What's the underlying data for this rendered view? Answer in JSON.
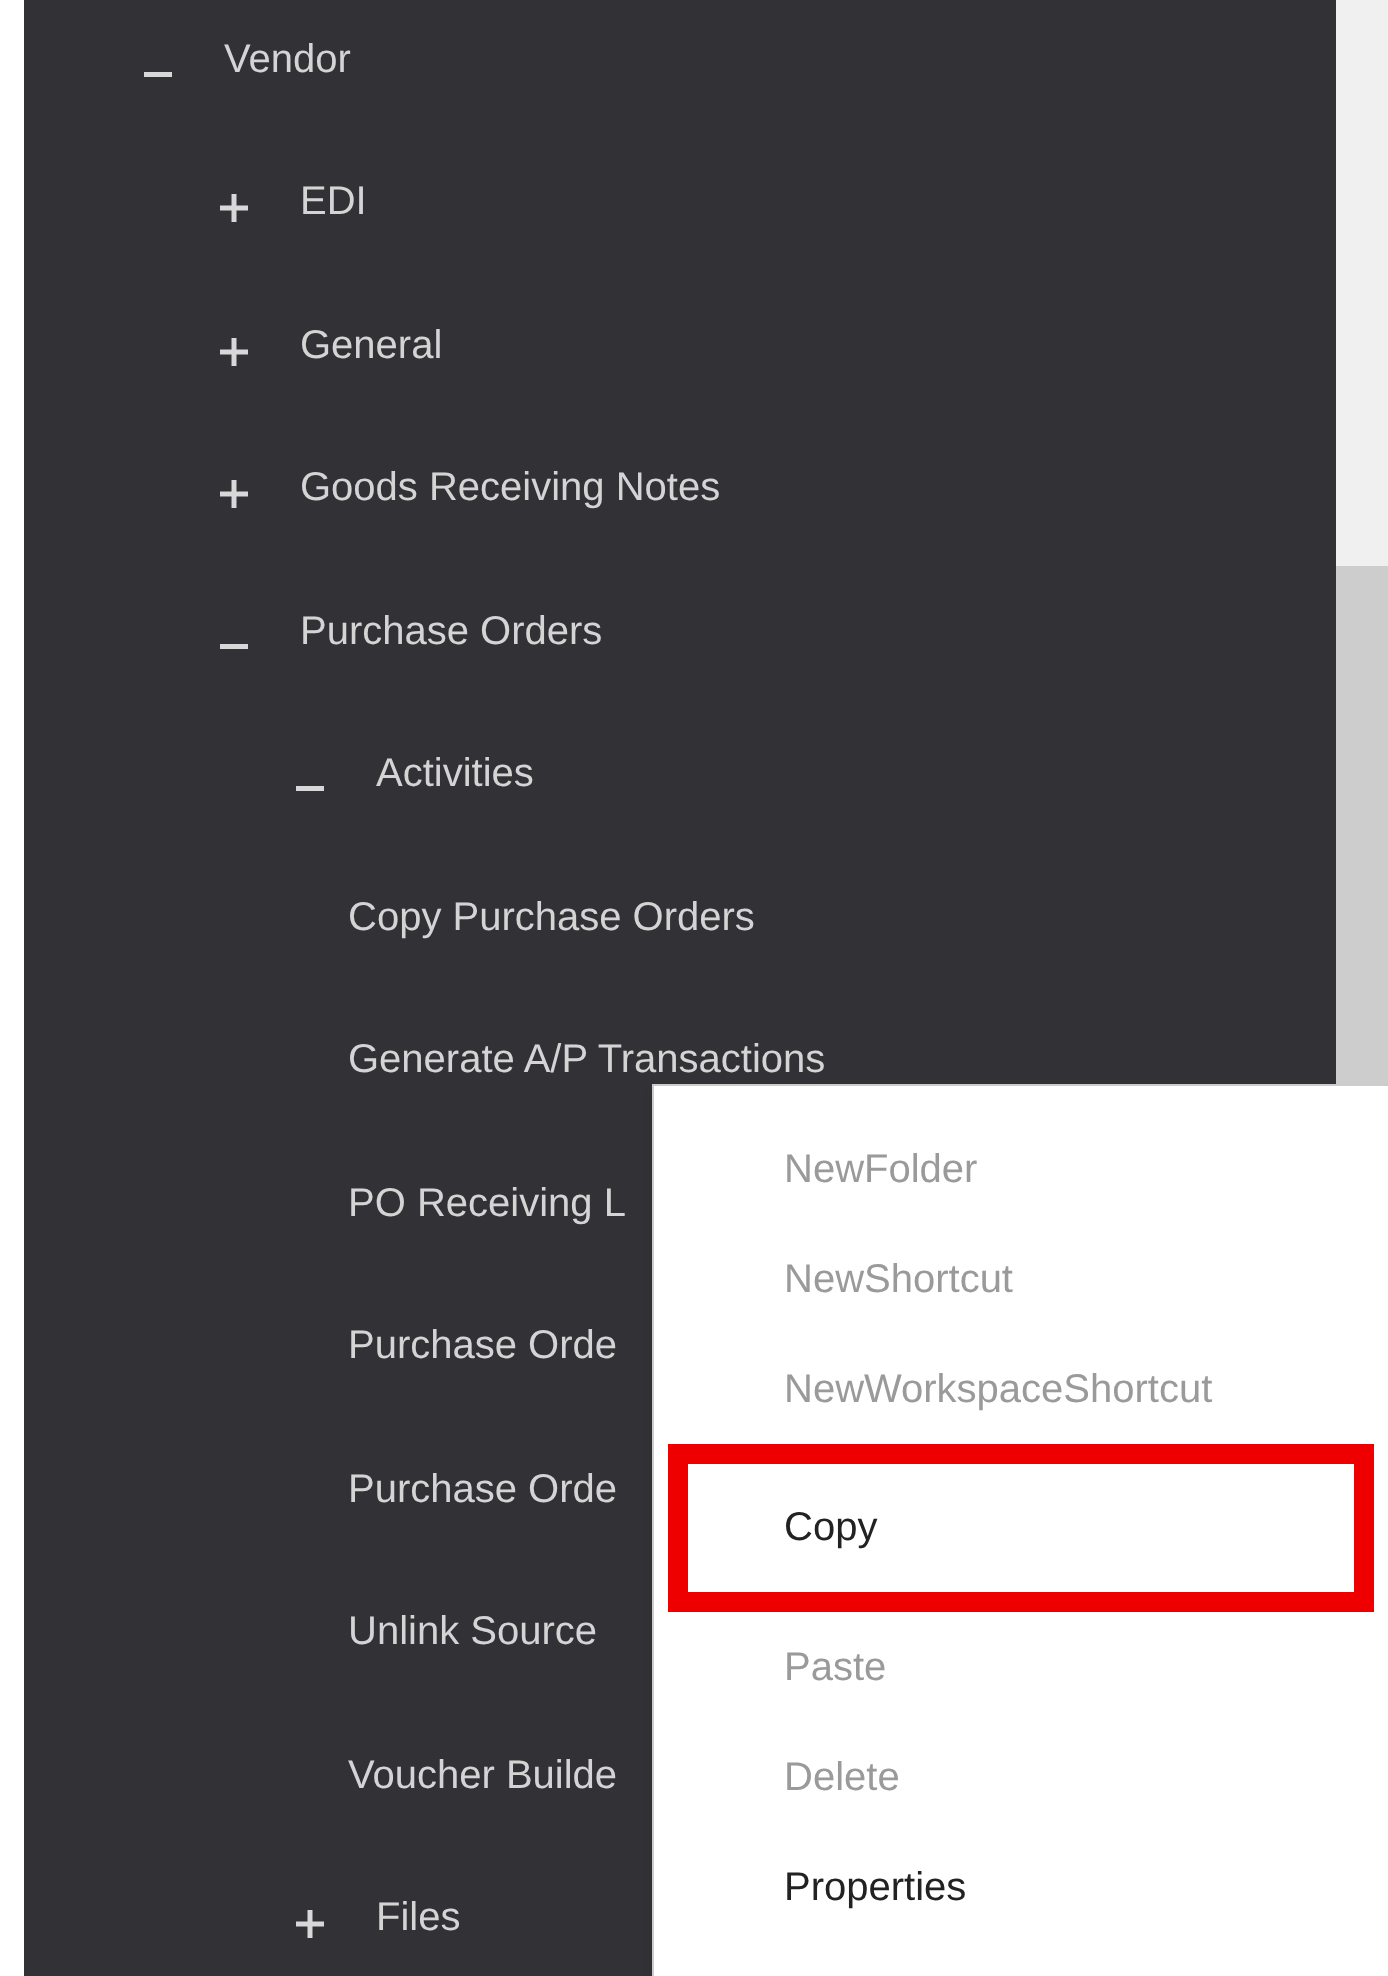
{
  "tree": [
    {
      "label": "Vendor",
      "expanded": true,
      "children": [
        {
          "label": "EDI",
          "expanded": false
        },
        {
          "label": "General",
          "expanded": false
        },
        {
          "label": "Goods Receiving Notes",
          "expanded": false
        },
        {
          "label": "Purchase Orders",
          "expanded": true,
          "children": [
            {
              "label": "Activities",
              "expanded": true,
              "children": [
                {
                  "label": "Copy Purchase Orders"
                },
                {
                  "label": "Generate A/P Transactions"
                },
                {
                  "label": "PO Receiving L"
                },
                {
                  "label": "Purchase Orde"
                },
                {
                  "label": "Purchase Orde"
                },
                {
                  "label": "Unlink Source"
                },
                {
                  "label": "Voucher Builde"
                }
              ]
            },
            {
              "label": "Files",
              "expanded": false
            }
          ]
        }
      ]
    }
  ],
  "context_menu": [
    {
      "label": "NewFolder",
      "disabled": true,
      "highlighted": false
    },
    {
      "label": "NewShortcut",
      "disabled": true,
      "highlighted": false
    },
    {
      "label": "NewWorkspaceShortcut",
      "disabled": true,
      "highlighted": false
    },
    {
      "label": "Copy",
      "disabled": false,
      "highlighted": true
    },
    {
      "label": "Paste",
      "disabled": true,
      "highlighted": false
    },
    {
      "label": "Delete",
      "disabled": true,
      "highlighted": false
    },
    {
      "label": "Properties",
      "disabled": false,
      "highlighted": false
    }
  ]
}
